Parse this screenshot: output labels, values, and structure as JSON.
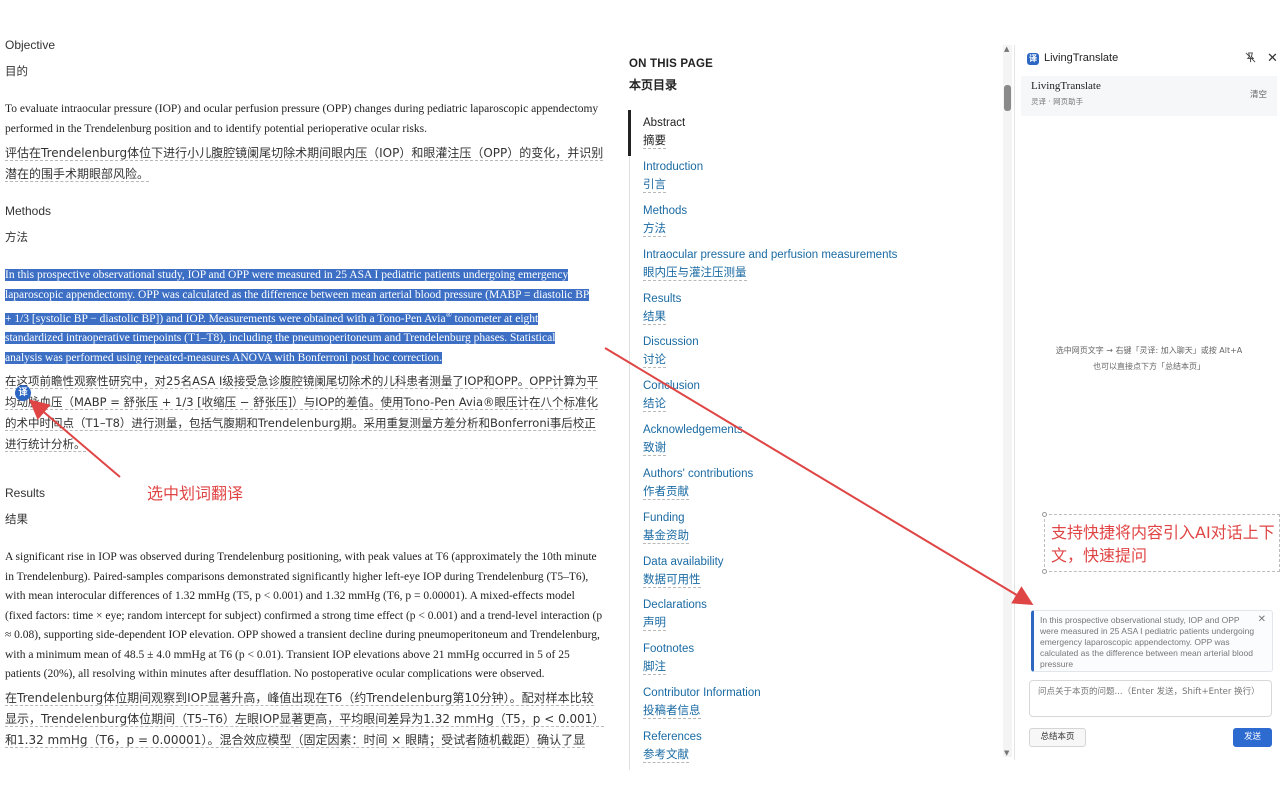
{
  "article": {
    "objective_heading_en": "Objective",
    "objective_heading_zh": "目的",
    "objective_en": "To evaluate intraocular pressure (IOP) and ocular perfusion pressure (OPP) changes during pediatric laparoscopic appendectomy performed in the Trendelenburg position and to identify potential perioperative ocular risks.",
    "objective_zh": "评估在Trendelenburg体位下进行小儿腹腔镜阑尾切除术期间眼内压（IOP）和眼灌注压（OPP）的变化，并识别潜在的围手术期眼部风险。",
    "methods_heading_en": "Methods",
    "methods_heading_zh": "方法",
    "methods_en_1": "In this prospective observational study, IOP and OPP were measured in 25 ASA I pediatric patients undergoing emergency laparoscopic appendectomy. OPP was calculated as the difference between mean arterial blood pressure (MABP = diastolic BP + 1/3 [systolic BP − diastolic BP]) and IOP. Measurements were obtained with a Tono-Pen Avia",
    "methods_en_sup": "®",
    "methods_en_2": " tonometer at eight standardized intraoperative timepoints (T1–T8), including the pneumoperitoneum and Trendelenburg phases. Statistical analysis was performed using repeated-measures ANOVA with Bonferroni post hoc correction.",
    "methods_zh": "在这项前瞻性观察性研究中，对25名ASA I级接受急诊腹腔镜阑尾切除术的儿科患者测量了IOP和OPP。OPP计算为平均动脉血压（MABP = 舒张压 + 1/3 [收缩压 − 舒张压]）与IOP的差值。使用Tono-Pen Avia®眼压计在八个标准化的术中时间点（T1–T8）进行测量，包括气腹期和Trendelenburg期。采用重复测量方差分析和Bonferroni事后校正进行统计分析。",
    "results_heading_en": "Results",
    "results_heading_zh": "结果",
    "results_en": "A significant rise in IOP was observed during Trendelenburg positioning, with peak values at T6 (approximately the 10th minute in Trendelenburg). Paired-samples comparisons demonstrated significantly higher left-eye IOP during Trendelenburg (T5–T6), with mean interocular differences of 1.32 mmHg (T5, p < 0.001) and 1.32 mmHg (T6, p = 0.00001). A mixed-effects model (fixed factors: time × eye; random intercept for subject) confirmed a strong time effect (p < 0.001) and a trend-level interaction (p ≈ 0.08), supporting side-dependent IOP elevation. OPP showed a transient decline during pneumoperitoneum and Trendelenburg, with a minimum mean of 48.5 ± 4.0 mmHg at T6 (p < 0.01). Transient IOP elevations above 21 mmHg occurred in 5 of 25 patients (20%), all resolving within minutes after desufflation. No postoperative ocular complications were observed.",
    "results_zh": "在Trendelenburg体位期间观察到IOP显著升高，峰值出现在T6（约Trendelenburg第10分钟）。配对样本比较显示，Trendelenburg体位期间（T5–T6）左眼IOP显著更高，平均眼间差异为1.32 mmHg（T5，p < 0.001）和1.32 mmHg（T6，p = 0.00001）。混合效应模型（固定因素：时间 × 眼睛；受试者随机截距）确认了显",
    "translate_badge": "译"
  },
  "toc": {
    "title_en": "ON THIS PAGE",
    "title_zh": "本页目录",
    "items": [
      {
        "en": "Abstract",
        "zh": "摘要"
      },
      {
        "en": "Introduction",
        "zh": "引言"
      },
      {
        "en": "Methods",
        "zh": "方法"
      },
      {
        "en": "Intraocular pressure and perfusion measurements",
        "zh": "眼内压与灌注压测量"
      },
      {
        "en": "Results",
        "zh": "结果"
      },
      {
        "en": "Discussion",
        "zh": "讨论"
      },
      {
        "en": "Conclusion",
        "zh": "结论"
      },
      {
        "en": "Acknowledgements",
        "zh": "致谢"
      },
      {
        "en": "Authors' contributions",
        "zh": "作者贡献"
      },
      {
        "en": "Funding",
        "zh": "基金资助"
      },
      {
        "en": "Data availability",
        "zh": "数据可用性"
      },
      {
        "en": "Declarations",
        "zh": "声明"
      },
      {
        "en": "Footnotes",
        "zh": "脚注"
      },
      {
        "en": "Contributor Information",
        "zh": "投稿者信息"
      },
      {
        "en": "References",
        "zh": "参考文献"
      }
    ]
  },
  "panel": {
    "window_title": "LivingTranslate",
    "icon_glyph": "译",
    "header_title": "LivingTranslate",
    "header_subtitle": "灵译 · 网页助手",
    "clear_label": "清空",
    "hint_line1": "选中网页文字 → 右键「灵译: 加入聊天」或按 Alt+A",
    "hint_line2": "也可以直接点下方「总结本页」",
    "quote_text": "In this prospective observational study, IOP and OPP were measured in 25 ASA I pediatric patients undergoing emergency laparoscopic appendectomy. OPP was calculated as the difference between mean arterial blood pressure",
    "input_placeholder": "问点关于本页的问题...（Enter 发送，Shift+Enter 换行）",
    "summary_label": "总结本页",
    "send_label": "发送"
  },
  "annotations": {
    "select_translate": "选中划词翻译",
    "ai_context": "支持快捷将内容引入AI对话上下文，快速提问"
  },
  "colors": {
    "highlight": "#3d6fc4",
    "link": "#1a6aa3",
    "accent": "#2d6bd1",
    "annotation": "#e04545"
  }
}
